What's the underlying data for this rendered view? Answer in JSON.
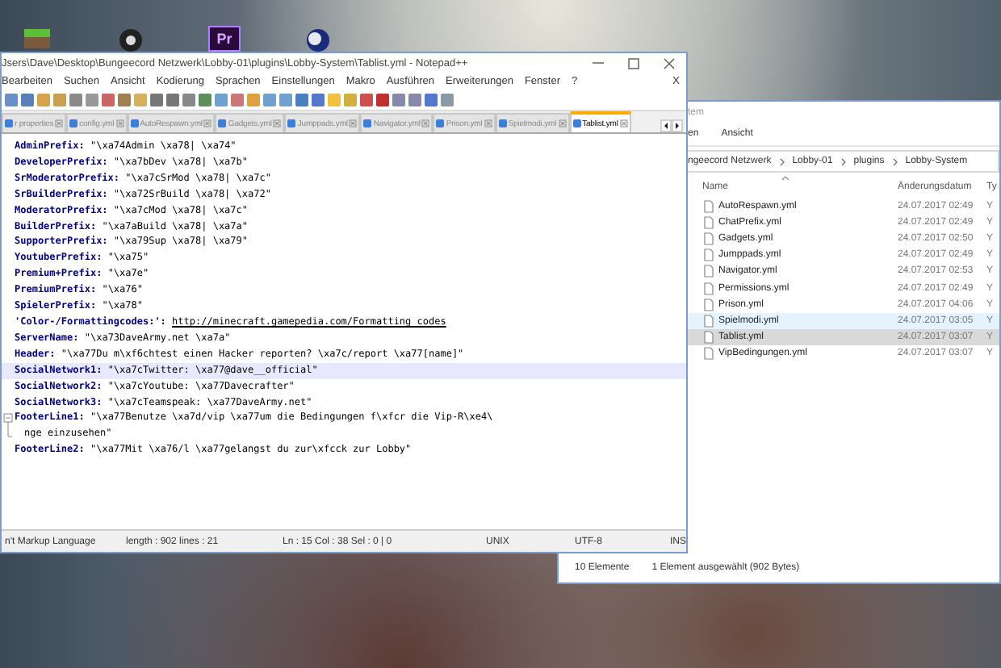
{
  "desktop": {
    "icons": [
      {
        "kind": "cube"
      },
      {
        "kind": "record"
      },
      {
        "kind": "premiere",
        "label": "Pr"
      },
      {
        "kind": "sphere"
      }
    ]
  },
  "notepad": {
    "title": "Jsers\\Dave\\Desktop\\Bungeecord Netzwerk\\Lobby-01\\plugins\\Lobby-System\\Tablist.yml - Notepad++",
    "menu": [
      "Bearbeiten",
      "Suchen",
      "Ansicht",
      "Kodierung",
      "Sprachen",
      "Einstellungen",
      "Makro",
      "Ausführen",
      "Erweiterungen",
      "Fenster",
      "?"
    ],
    "menu_close": "X",
    "tabs": [
      {
        "label": "r properties",
        "selected": false
      },
      {
        "label": "config.yml",
        "selected": false
      },
      {
        "label": "AutoRespawn.yml",
        "selected": false
      },
      {
        "label": "Gadgets.yml",
        "selected": false
      },
      {
        "label": "Jumppads.yml",
        "selected": false
      },
      {
        "label": "Navigator.yml",
        "selected": false
      },
      {
        "label": "Prison.yml",
        "selected": false
      },
      {
        "label": "Spielmodi.yml",
        "selected": false
      },
      {
        "label": "Tablist.yml",
        "selected": true
      }
    ],
    "lines": [
      {
        "key": "AdminPrefix:",
        "value": "\"\\xa74Admin \\xa78| \\xa74\"",
        "kind": "text",
        "current": false,
        "foldable": false
      },
      {
        "key": "DeveloperPrefix:",
        "value": "\"\\xa7bDev \\xa78| \\xa7b\"",
        "kind": "text",
        "current": false,
        "foldable": false
      },
      {
        "key": "SrModeratorPrefix:",
        "value": "\"\\xa7cSrMod \\xa78| \\xa7c\"",
        "kind": "text",
        "current": false,
        "foldable": false
      },
      {
        "key": "SrBuilderPrefix:",
        "value": "\"\\xa72SrBuild \\xa78| \\xa72\"",
        "kind": "text",
        "current": false,
        "foldable": false
      },
      {
        "key": "ModeratorPrefix:",
        "value": "\"\\xa7cMod \\xa78| \\xa7c\"",
        "kind": "text",
        "current": false,
        "foldable": false
      },
      {
        "key": "BuilderPrefix:",
        "value": "\"\\xa7aBuild \\xa78| \\xa7a\"",
        "kind": "text",
        "current": false,
        "foldable": false
      },
      {
        "key": "SupporterPrefix:",
        "value": "\"\\xa79Sup \\xa78| \\xa79\"",
        "kind": "text",
        "current": false,
        "foldable": false
      },
      {
        "key": "YoutuberPrefix:",
        "value": "\"\\xa75\"",
        "kind": "text",
        "current": false,
        "foldable": false
      },
      {
        "key": "Premium+Prefix:",
        "value": "\"\\xa7e\"",
        "kind": "text",
        "current": false,
        "foldable": false
      },
      {
        "key": "PremiumPrefix:",
        "value": "\"\\xa76\"",
        "kind": "text",
        "current": false,
        "foldable": false
      },
      {
        "key": "SpielerPrefix:",
        "value": "\"\\xa78\"",
        "kind": "text",
        "current": false,
        "foldable": false
      },
      {
        "key": "'Color-/Formattingcodes:':",
        "value": "http://minecraft.gamepedia.com/Formatting_codes",
        "kind": "link",
        "current": false,
        "foldable": false
      },
      {
        "key": "ServerName:",
        "value": "\"\\xa73DaveArmy.net \\xa7a\"",
        "kind": "text",
        "current": false,
        "foldable": false
      },
      {
        "key": "Header:",
        "value": "\"\\xa77Du m\\xf6chtest einen Hacker reporten? \\xa7c/report \\xa77[name]\"",
        "kind": "text",
        "current": false,
        "foldable": false
      },
      {
        "key": "SocialNetwork1:",
        "value": "\"\\xa7cTwitter: \\xa77@dave__official\"",
        "kind": "text",
        "current": true,
        "foldable": false
      },
      {
        "key": "SocialNetwork2:",
        "value": "\"\\xa7cYoutube: \\xa77Davecrafter\"",
        "kind": "text",
        "current": false,
        "foldable": false
      },
      {
        "key": "SocialNetwork3:",
        "value": "\"\\xa7cTeamspeak: \\xa77DaveArmy.net\"",
        "kind": "text",
        "current": false,
        "foldable": false
      },
      {
        "key": "FooterLine1:",
        "value": "\"\\xa77Benutze \\xa7d/vip \\xa77um die Bedingungen f\\xfcr die Vip-R\\xe4\\",
        "continuation": "nge einzusehen\"",
        "kind": "text",
        "current": false,
        "foldable": true
      },
      {
        "key": "FooterLine2:",
        "value": "\"\\xa77Mit \\xa76/l \\xa77gelangst du zur\\xfcck zur Lobby\"",
        "kind": "text",
        "current": false,
        "foldable": false
      }
    ],
    "status_bar": [
      "n't Markup Language",
      "length : 902    lines : 21",
      "Ln : 15    Col : 38    Sel : 0 | 0",
      "UNIX",
      "UTF-8",
      "INS"
    ]
  },
  "explorer": {
    "title": "tem",
    "ribbon": [
      "en",
      "Ansicht"
    ],
    "path": [
      "ngeecord Netzwerk",
      "Lobby-01",
      "plugins",
      "Lobby-System"
    ],
    "columns": [
      "Name",
      "Änderungsdatum",
      "Ty"
    ],
    "files": [
      {
        "name": "AutoRespawn.yml",
        "date": "24.07.2017 02:49",
        "column_3": "Y",
        "selected": false,
        "hovered": false
      },
      {
        "name": "ChatPrefix.yml",
        "date": "24.07.2017 02:49",
        "column_3": "Y",
        "selected": false,
        "hovered": false
      },
      {
        "name": "Gadgets.yml",
        "date": "24.07.2017 02:50",
        "column_3": "Y",
        "selected": false,
        "hovered": false
      },
      {
        "name": "Jumppads.yml",
        "date": "24.07.2017 02:49",
        "column_3": "Y",
        "selected": false,
        "hovered": false
      },
      {
        "name": "Navigator.yml",
        "date": "24.07.2017 02:53",
        "column_3": "Y",
        "selected": false,
        "hovered": false
      },
      {
        "name": "Permissions.yml",
        "date": "24.07.2017 02:49",
        "column_3": "Y",
        "selected": false,
        "hovered": false
      },
      {
        "name": "Prison.yml",
        "date": "24.07.2017 04:06",
        "column_3": "Y",
        "selected": false,
        "hovered": false
      },
      {
        "name": "Spielmodi.yml",
        "date": "24.07.2017 03:05",
        "column_3": "Y",
        "selected": false,
        "hovered": true
      },
      {
        "name": "Tablist.yml",
        "date": "24.07.2017 03:07",
        "column_3": "Y",
        "selected": true,
        "hovered": false
      },
      {
        "name": "VipBedingungen.yml",
        "date": "24.07.2017 03:07",
        "column_3": "Y",
        "selected": false,
        "hovered": false
      }
    ],
    "status": [
      "10 Elemente",
      "1 Element ausgewählt (902 Bytes)"
    ]
  }
}
